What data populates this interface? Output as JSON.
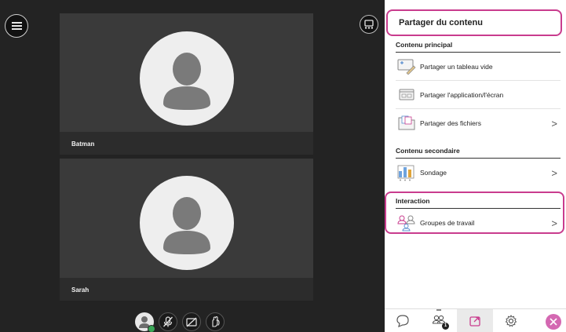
{
  "stage": {
    "participants": [
      {
        "name": "Batman",
        "icon": "user-silhouette-icon"
      },
      {
        "name": "Sarah",
        "icon": "user-silhouette-icon"
      }
    ],
    "controls": [
      {
        "icon": "my-status-avatar-icon",
        "state": "available"
      },
      {
        "icon": "microphone-muted-icon"
      },
      {
        "icon": "camera-off-icon"
      },
      {
        "icon": "raise-hand-icon"
      }
    ],
    "menu_icon": "hamburger-menu-icon",
    "layout_icon": "layout-toggle-icon"
  },
  "panel": {
    "title": "Partager du contenu",
    "sections": [
      {
        "title": "Contenu principal",
        "items": [
          {
            "label": "Partager un tableau vide",
            "icon": "whiteboard-icon",
            "chevron": false
          },
          {
            "label": "Partager l'application/l'écran",
            "icon": "screen-share-icon",
            "chevron": false
          },
          {
            "label": "Partager des fichiers",
            "icon": "folder-files-icon",
            "chevron": true
          }
        ]
      },
      {
        "title": "Contenu secondaire",
        "items": [
          {
            "label": "Sondage",
            "icon": "poll-bars-icon",
            "chevron": true
          }
        ]
      },
      {
        "title": "Interaction",
        "items": [
          {
            "label": "Groupes de travail",
            "icon": "breakout-groups-icon",
            "chevron": true
          }
        ]
      }
    ],
    "chevron_glyph": ">",
    "tabs": [
      {
        "icon": "chat-icon",
        "active": false
      },
      {
        "icon": "attendees-icon",
        "active": false,
        "badge": "1"
      },
      {
        "icon": "share-content-icon",
        "active": true
      },
      {
        "icon": "settings-gear-icon",
        "active": false
      }
    ],
    "close_icon": "close-icon"
  },
  "colors": {
    "highlight": "#c93c8e",
    "close_button": "#d468b2",
    "stage_bg": "#232323",
    "tile_bg": "#3a3a3a",
    "status_available": "#3aa757"
  }
}
